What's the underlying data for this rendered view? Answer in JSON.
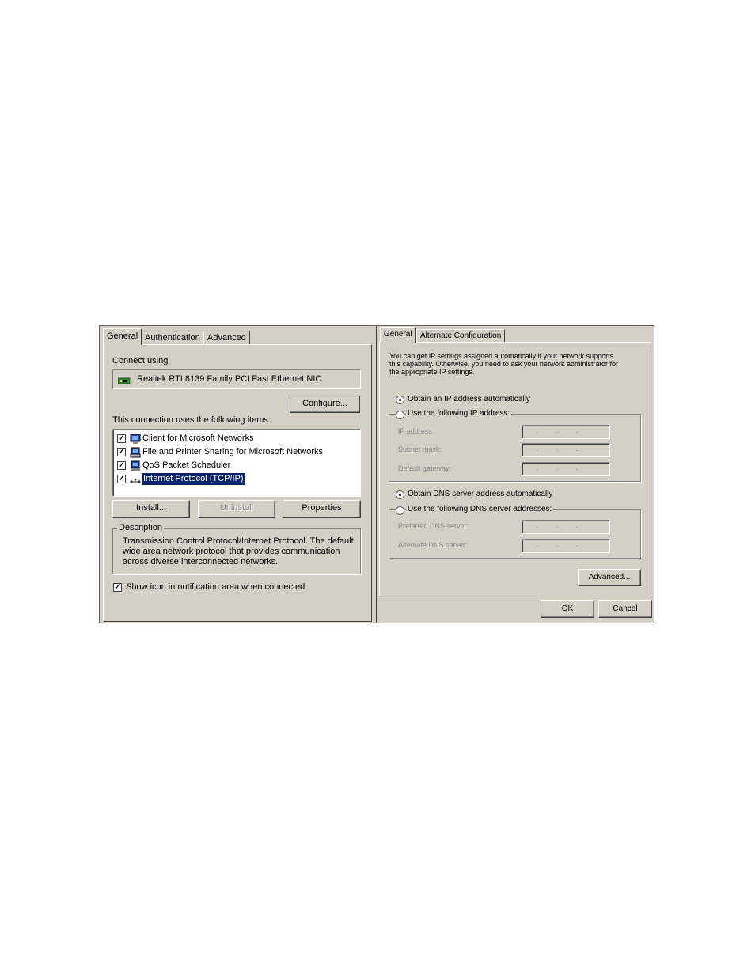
{
  "left_dialog": {
    "tabs": [
      "General",
      "Authentication",
      "Advanced"
    ],
    "connect_using_label": "Connect using:",
    "adapter_name": "Realtek RTL8139 Family PCI Fast Ethernet NIC",
    "configure_button": "Configure...",
    "items_label": "This connection uses the following items:",
    "items": [
      {
        "label": "Client for Microsoft Networks",
        "checked": true,
        "icon": "network-client-icon"
      },
      {
        "label": "File and Printer Sharing for Microsoft Networks",
        "checked": true,
        "icon": "file-printer-sharing-icon"
      },
      {
        "label": "QoS Packet Scheduler",
        "checked": true,
        "icon": "qos-scheduler-icon"
      },
      {
        "label": "Internet Protocol (TCP/IP)",
        "checked": true,
        "selected": true,
        "icon": "protocol-icon"
      }
    ],
    "install_button": "Install...",
    "uninstall_button": "Uninstall",
    "properties_button": "Properties",
    "description_legend": "Description",
    "description_lines": [
      "Transmission Control Protocol/Internet Protocol. The default",
      "wide area network protocol that provides communication",
      "across diverse interconnected networks."
    ],
    "show_icon_label": "Show icon in notification area when connected",
    "show_icon_checked": true
  },
  "right_dialog": {
    "tabs": [
      "General",
      "Alternate Configuration"
    ],
    "intro_lines": [
      "You can get IP settings assigned automatically if your network supports",
      "this capability. Otherwise, you need to ask your network administrator for",
      "the appropriate IP settings."
    ],
    "obtain_ip_auto": "Obtain an IP address automatically",
    "use_following_ip": "Use the following IP address:",
    "ip_address_label": "IP address:",
    "subnet_mask_label": "Subnet mask:",
    "default_gateway_label": "Default gateway:",
    "obtain_dns_auto": "Obtain DNS server address automatically",
    "use_following_dns": "Use the following DNS server addresses:",
    "preferred_dns_label": "Preferred DNS server:",
    "alternate_dns_label": "Alternate DNS server:",
    "ip_placeholder": "...",
    "advanced_button": "Advanced...",
    "ok_button": "OK",
    "cancel_button": "Cancel"
  },
  "colors": {
    "dialog_bg": "#d4d0c8",
    "selection": "#0a246a"
  }
}
